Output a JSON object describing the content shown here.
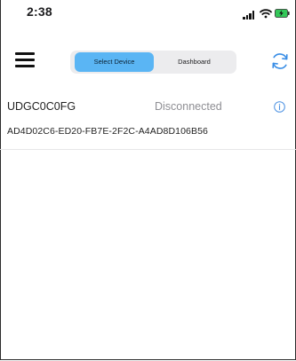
{
  "status_bar": {
    "time": "2:38"
  },
  "nav": {
    "segments": [
      {
        "label": "Select Device",
        "active": true
      },
      {
        "label": "Dashboard",
        "active": false
      }
    ]
  },
  "devices": [
    {
      "name": "UDGC0C0FG",
      "status": "Disconnected",
      "id": "AD4D02C6-ED20-FB7E-2F2C-A4AD8D106B56"
    }
  ],
  "colors": {
    "accent": "#5ab5f4",
    "refresh_icon": "#3a8ee6",
    "info_icon": "#4a90e2",
    "battery_charging": "#34c759"
  },
  "icons": {
    "menu": "hamburger-icon",
    "refresh": "refresh-icon",
    "info": "info-icon"
  }
}
